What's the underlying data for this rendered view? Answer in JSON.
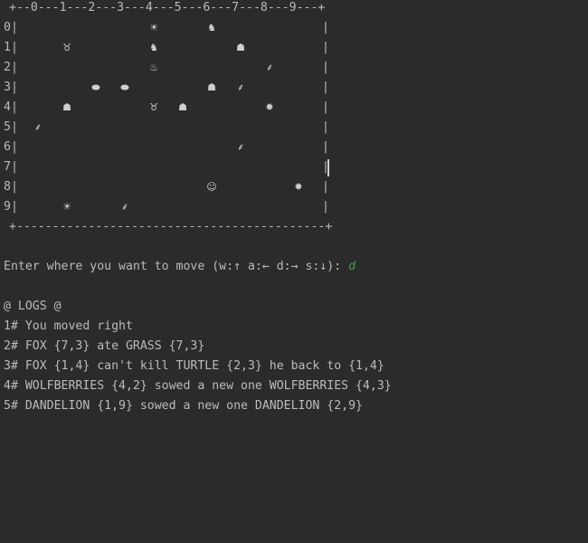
{
  "board": {
    "top_border": "+--0---1---2---3---4---5---6---7---8---9---+",
    "bottom_border": "+-------------------------------------------+",
    "row_labels": [
      "0|",
      "1|",
      "2|",
      "3|",
      "4|",
      "5|",
      "6|",
      "7|",
      "8|",
      "9|"
    ],
    "right_wall": "|",
    "cells": [
      {
        "col": 4,
        "row": 0,
        "glyph": "☀",
        "icon": "dandelion-icon"
      },
      {
        "col": 6,
        "row": 0,
        "glyph": "♞",
        "icon": "antelope-icon"
      },
      {
        "col": 1,
        "row": 1,
        "glyph": "♉",
        "icon": "sheep-icon"
      },
      {
        "col": 4,
        "row": 1,
        "glyph": "♞",
        "icon": "antelope-icon"
      },
      {
        "col": 7,
        "row": 1,
        "glyph": "☗",
        "icon": "wolf-icon"
      },
      {
        "col": 4,
        "row": 2,
        "glyph": "♨",
        "icon": "wolfberries-icon"
      },
      {
        "col": 8,
        "row": 2,
        "glyph": "⸙",
        "icon": "grass-icon"
      },
      {
        "col": 2,
        "row": 3,
        "glyph": "⬬",
        "icon": "turtle-icon"
      },
      {
        "col": 3,
        "row": 3,
        "glyph": "⬬",
        "icon": "turtle-icon"
      },
      {
        "col": 6,
        "row": 3,
        "glyph": "☗",
        "icon": "fox-icon"
      },
      {
        "col": 7,
        "row": 3,
        "glyph": "⸙",
        "icon": "grass-icon"
      },
      {
        "col": 1,
        "row": 4,
        "glyph": "☗",
        "icon": "fox-icon"
      },
      {
        "col": 4,
        "row": 4,
        "glyph": "♉",
        "icon": "sheep-icon"
      },
      {
        "col": 5,
        "row": 4,
        "glyph": "☗",
        "icon": "wolf-icon"
      },
      {
        "col": 8,
        "row": 4,
        "glyph": "✹",
        "icon": "hogweed-icon"
      },
      {
        "col": 0,
        "row": 5,
        "glyph": "⸙",
        "icon": "grass-icon"
      },
      {
        "col": 7,
        "row": 6,
        "glyph": "⸙",
        "icon": "grass-icon"
      },
      {
        "col": 6,
        "row": 8,
        "glyph": "☺",
        "icon": "human-player-icon"
      },
      {
        "col": 9,
        "row": 8,
        "glyph": "✹",
        "icon": "hogweed-icon"
      },
      {
        "col": 1,
        "row": 9,
        "glyph": "☀",
        "icon": "dandelion-icon"
      },
      {
        "col": 3,
        "row": 9,
        "glyph": "⸙",
        "icon": "grass-icon"
      }
    ]
  },
  "prompt": {
    "text": "Enter where you want to move (w:↑ a:← d:→ s:↓): ",
    "input_value": "d"
  },
  "logs": {
    "title": "@ LOGS @",
    "entries": [
      "1# You moved right",
      "2# FOX {7,3} ate GRASS {7,3}",
      "3# FOX {1,4} can't kill TURTLE {2,3} he back to {1,4}",
      "4# WOLFBERRIES {4,2} sowed a new one WOLFBERRIES {4,3}",
      "5# DANDELION {1,9} sowed a new one DANDELION {2,9}"
    ]
  },
  "colors": {
    "background": "#2b2b2b",
    "text": "#bbbbbb",
    "input": "#3fa34d"
  }
}
